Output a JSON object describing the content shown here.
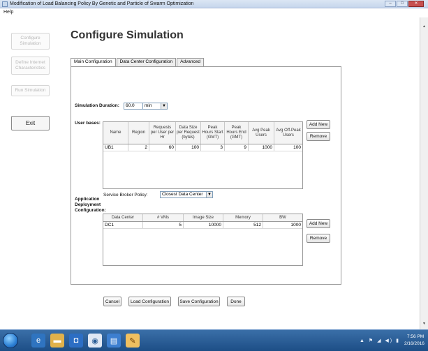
{
  "window": {
    "title": "Modification of Load Balancing Policy By Genetic and Particle of Swarm Optimization",
    "minimize": "–",
    "maximize": "□",
    "close": "✕"
  },
  "menu": {
    "help": "Help"
  },
  "sidebar": {
    "configure": "Configure Simulation",
    "define_internet": "Define Internet Characteristics",
    "run": "Run Simulation",
    "exit": "Exit"
  },
  "page": {
    "title": "Configure Simulation"
  },
  "tabs": [
    "Main Configuration",
    "Data Center Configuration",
    "Advanced"
  ],
  "simulation": {
    "duration_label": "Simulation Duration:",
    "duration_value": "60.0",
    "unit": "min"
  },
  "user_bases": {
    "label": "User bases:",
    "columns": [
      "Name",
      "Region",
      "Requests per User per Hr",
      "Data Size per Request (bytes)",
      "Peak Hours Start (GMT)",
      "Peak Hours End (GMT)",
      "Avg Peak Users",
      "Avg Off-Peak Users"
    ],
    "rows": [
      [
        "UB1",
        "2",
        "60",
        "100",
        "3",
        "9",
        "1000",
        "100"
      ]
    ],
    "add_new": "Add New",
    "remove": "Remove"
  },
  "deployment": {
    "label_line1": "Application",
    "label_line2": "Deployment",
    "label_line3": "Configuration:",
    "broker_label": "Service Broker Policy:",
    "broker_value": "Closest Data Center",
    "columns": [
      "Data Center",
      "# VMs",
      "Image Size",
      "Memory",
      "BW"
    ],
    "rows": [
      [
        "DC1",
        "5",
        "10000",
        "512",
        "1000"
      ]
    ],
    "add_new": "Add New",
    "remove": "Remove"
  },
  "footer": {
    "cancel": "Cancel",
    "load": "Load Configuration",
    "save": "Save Configuration",
    "done": "Done"
  },
  "taskbar": {
    "time": "7:56 PM",
    "date": "2/16/2016",
    "tray": "▲ ⚑ ◢ ◀) ▮"
  },
  "colors": {
    "taskbar": "#2a5d96",
    "titlebar": "#c6d6ec",
    "close_button": "#c75050"
  }
}
